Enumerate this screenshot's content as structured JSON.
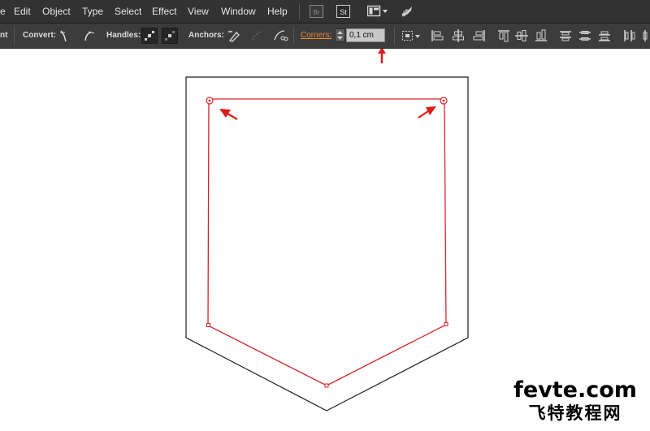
{
  "menubar": {
    "items": [
      {
        "label": "e"
      },
      {
        "label": "Edit"
      },
      {
        "label": "Object"
      },
      {
        "label": "Type"
      },
      {
        "label": "Select"
      },
      {
        "label": "Effect"
      },
      {
        "label": "View"
      },
      {
        "label": "Window"
      },
      {
        "label": "Help"
      }
    ],
    "icons": {
      "bridge": "Br",
      "stock": "St",
      "workspace": "workspace-switcher-icon",
      "gpu": "rocket-icon"
    }
  },
  "control_bar": {
    "cut_label": "nt",
    "convert_label": "Convert:",
    "handles_label": "Handles:",
    "anchors_label": "Anchors:",
    "corners_label": "Corners:",
    "corners_value": "0,1 cm"
  },
  "colors": {
    "menubar_bg": "#323232",
    "controlbar_bg": "#3c3c3c",
    "corners_label": "#e8883a",
    "selection_path": "#d4242a",
    "arrow": "#d91e18",
    "artwork_stroke": "#1a1a1a"
  },
  "watermark": {
    "line1": "fevte.com",
    "line2": "飞特教程网"
  }
}
